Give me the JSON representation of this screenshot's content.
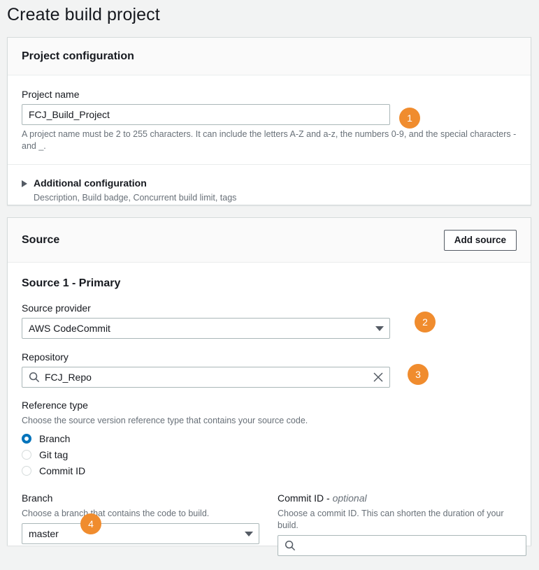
{
  "page": {
    "title": "Create build project"
  },
  "project_configuration": {
    "header": "Project configuration",
    "project_name": {
      "label": "Project name",
      "value": "FCJ_Build_Project",
      "placeholder": "",
      "hint": "A project name must be 2 to 255 characters. It can include the letters A-Z and a-z, the numbers 0-9, and the special characters - and _."
    },
    "additional_configuration": {
      "title": "Additional configuration",
      "subtitle": "Description, Build badge, Concurrent build limit, tags"
    }
  },
  "source": {
    "header": "Source",
    "add_source_label": "Add source",
    "source_heading": "Source 1 - Primary",
    "source_provider": {
      "label": "Source provider",
      "value": "AWS CodeCommit"
    },
    "repository": {
      "label": "Repository",
      "value": "FCJ_Repo",
      "placeholder": ""
    },
    "reference_type": {
      "label": "Reference type",
      "description": "Choose the source version reference type that contains your source code.",
      "options": [
        {
          "label": "Branch",
          "selected": true
        },
        {
          "label": "Git tag",
          "selected": false
        },
        {
          "label": "Commit ID",
          "selected": false
        }
      ]
    },
    "branch": {
      "label": "Branch",
      "description": "Choose a branch that contains the code to build.",
      "value": "master"
    },
    "commit_id": {
      "label": "Commit ID - ",
      "label_optional": "optional",
      "description": "Choose a commit ID. This can shorten the duration of your build.",
      "value": "",
      "placeholder": ""
    }
  },
  "badges": [
    {
      "number": "1"
    },
    {
      "number": "2"
    },
    {
      "number": "3"
    },
    {
      "number": "4"
    }
  ],
  "colors": {
    "badge_orange": "#f08c2e",
    "radio_blue": "#0073bb",
    "page_background": "#f2f3f3",
    "panel_background": "#ffffff",
    "panel_header_background": "#fafafa",
    "text_primary": "#16191f",
    "text_secondary": "#687078"
  }
}
